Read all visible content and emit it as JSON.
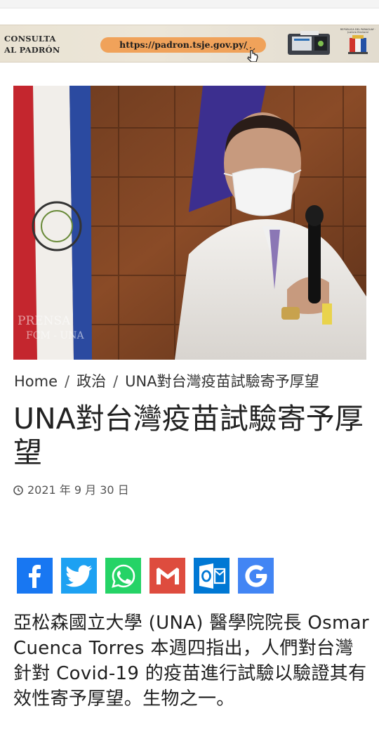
{
  "banner": {
    "title_line1": "CONSULTA",
    "title_line2": "AL PADRÓN",
    "url": "https://padron.tsje.gov.py/",
    "logo_text": "REPÚBLICA DEL PARAGUAY · Justicia Electoral"
  },
  "photo": {
    "watermark_line1": "PRENSA",
    "watermark_line2": "FCM - UNA",
    "description": "Man in white lab coat and face mask speaking into a microphone in front of the Paraguayan flag"
  },
  "breadcrumb": {
    "items": [
      "Home",
      "政治",
      "UNA對台灣疫苗試驗寄予厚望"
    ],
    "separator": "/"
  },
  "article": {
    "title": "UNA對台灣疫苗試驗寄予厚望",
    "date": "2021 年 9 月 30 日",
    "body": "亞松森國立大學 (UNA) 醫學院院長 Osmar Cuenca Torres 本週四指出，人們對台灣針對 Covid-19 的疫苗進行試驗以驗證其有效性寄予厚望。生物之一。"
  },
  "share": {
    "buttons": [
      {
        "name": "facebook",
        "color": "#1877f2"
      },
      {
        "name": "twitter",
        "color": "#1da1f2"
      },
      {
        "name": "whatsapp",
        "color": "#25d366"
      },
      {
        "name": "gmail",
        "color": "#de4c3e"
      },
      {
        "name": "outlook",
        "color": "#0078d4"
      },
      {
        "name": "google",
        "color": "#4285f4"
      }
    ]
  },
  "icons": {
    "date": "clock-icon"
  }
}
